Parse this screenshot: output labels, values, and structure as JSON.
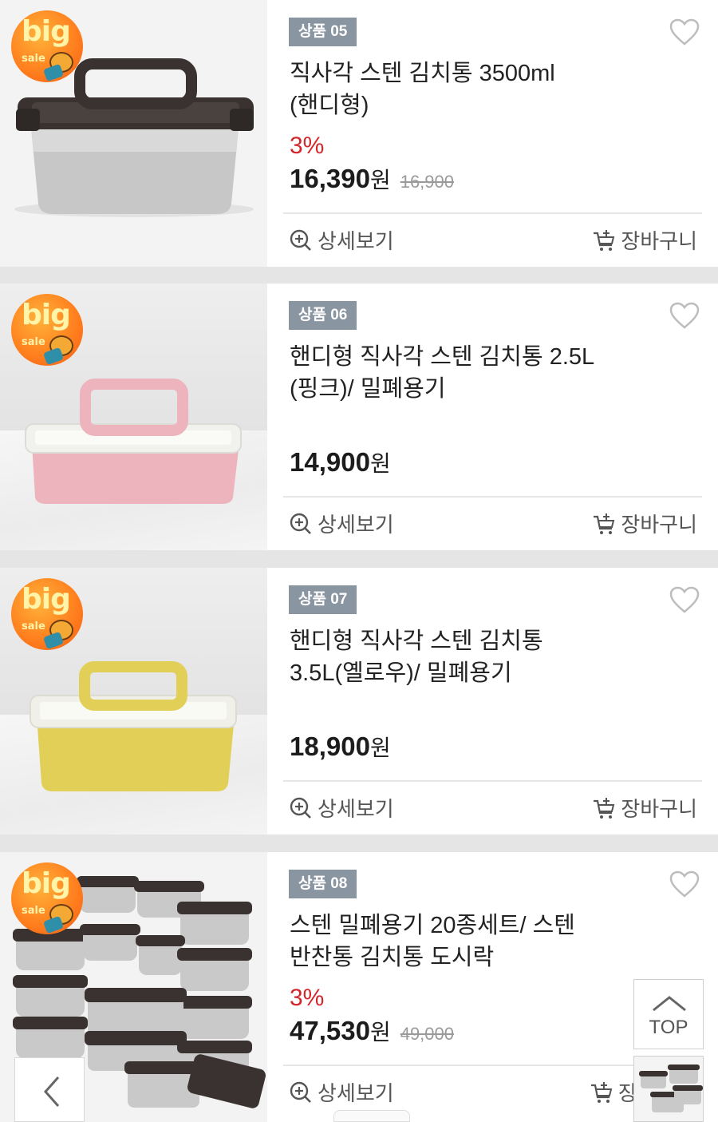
{
  "products": [
    {
      "tag": "상품 05",
      "title_line1": "직사각 스텐 김치통 3500ml",
      "title_line2": "(핸디형)",
      "discount": "3%",
      "price": "16,390",
      "unit": "원",
      "original_price": "16,900",
      "detail_label": "상세보기",
      "cart_label": "장바구니",
      "badge_text": "big",
      "badge_sub": "sale",
      "lid_color": "#3a3230",
      "body_color": "#c9c9c9"
    },
    {
      "tag": "상품 06",
      "title_line1": "핸디형 직사각 스텐 김치통 2.5L",
      "title_line2": "(핑크)/ 밀폐용기",
      "discount": "",
      "price": "14,900",
      "unit": "원",
      "original_price": "",
      "detail_label": "상세보기",
      "cart_label": "장바구니",
      "badge_text": "big",
      "badge_sub": "sale",
      "lid_color": "#f1f1ee",
      "body_color": "#eeb4bd"
    },
    {
      "tag": "상품 07",
      "title_line1": "핸디형 직사각 스텐 김치통",
      "title_line2": "3.5L(옐로우)/ 밀폐용기",
      "discount": "",
      "price": "18,900",
      "unit": "원",
      "original_price": "",
      "detail_label": "상세보기",
      "cart_label": "장바구니",
      "badge_text": "big",
      "badge_sub": "sale",
      "lid_color": "#f1f0e8",
      "body_color": "#e2cf58"
    },
    {
      "tag": "상품 08",
      "title_line1": "스텐 밀폐용기 20종세트/ 스텐",
      "title_line2": "반찬통 김치통 도시락",
      "discount": "3%",
      "price": "47,530",
      "unit": "원",
      "original_price": "49,000",
      "detail_label": "상세보기",
      "cart_label": "장",
      "badge_text": "big",
      "badge_sub": "sale",
      "lid_color": "#3a3230",
      "body_color": "#c9c9c9"
    }
  ],
  "floating": {
    "top_label": "TOP"
  },
  "colors": {
    "tag_bg": "#8a95a2",
    "discount": "#d2262b",
    "badge": "#ff7d1d"
  }
}
